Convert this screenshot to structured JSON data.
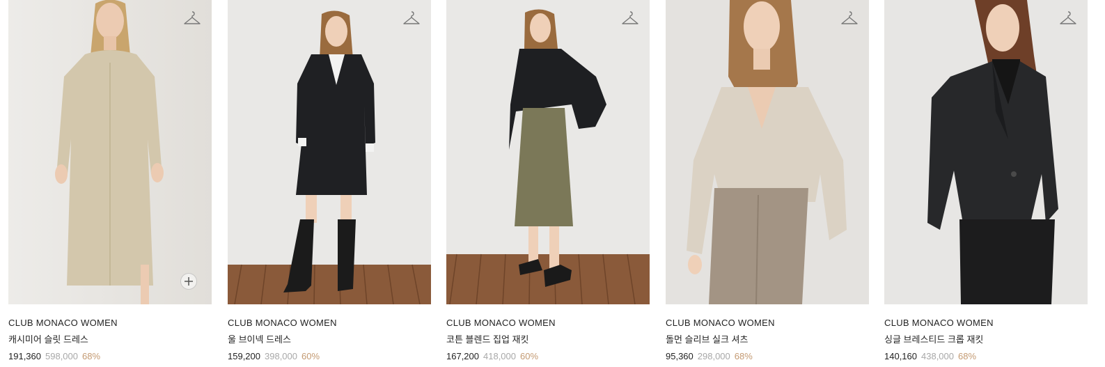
{
  "colors": {
    "price": "#222222",
    "original_price": "#a8a8a8",
    "discount": "#c49a72",
    "photo_background": "#e6e4df",
    "floor": "#8a5a3a"
  },
  "icons": {
    "wishlist": "hanger-icon",
    "quick_add": "plus-icon"
  },
  "products": [
    {
      "brand": "CLUB MONACO WOMEN",
      "name": "캐시미어 슬릿 드레스",
      "price": "191,360",
      "original_price": "598,000",
      "discount": "68%"
    },
    {
      "brand": "CLUB MONACO WOMEN",
      "name": "울 브이넥 드레스",
      "price": "159,200",
      "original_price": "398,000",
      "discount": "60%"
    },
    {
      "brand": "CLUB MONACO WOMEN",
      "name": "코튼 블렌드 집업 재킷",
      "price": "167,200",
      "original_price": "418,000",
      "discount": "60%"
    },
    {
      "brand": "CLUB MONACO WOMEN",
      "name": "돌먼 슬리브 실크 셔츠",
      "price": "95,360",
      "original_price": "298,000",
      "discount": "68%"
    },
    {
      "brand": "CLUB MONACO WOMEN",
      "name": "싱글 브레스티드 크롭 재킷",
      "price": "140,160",
      "original_price": "438,000",
      "discount": "68%"
    }
  ]
}
